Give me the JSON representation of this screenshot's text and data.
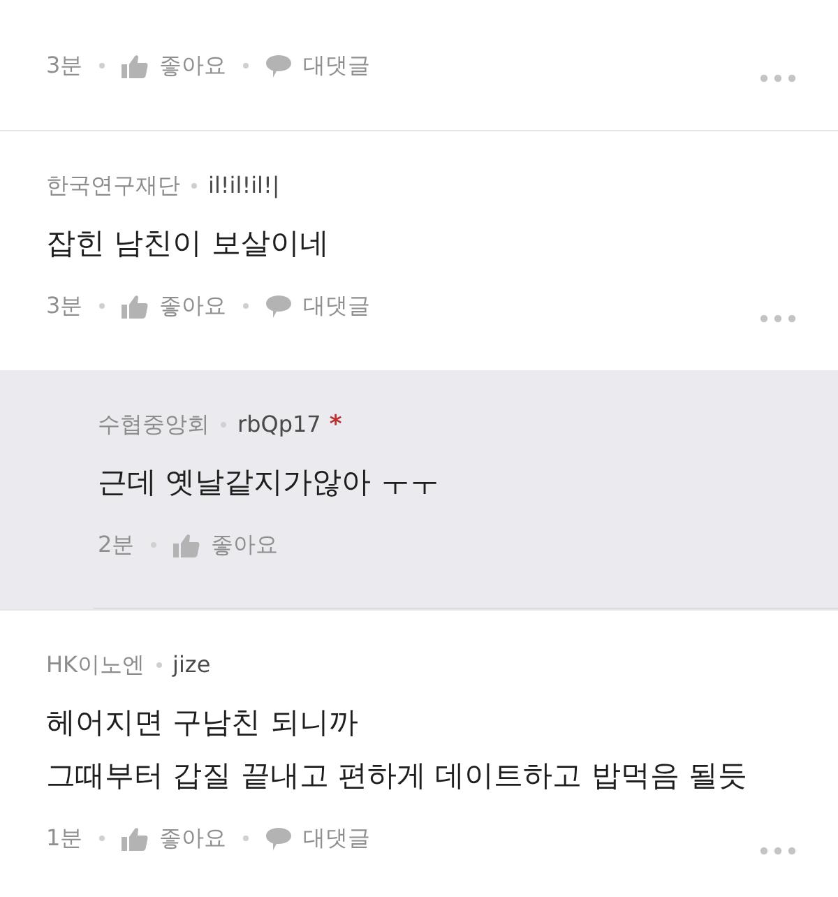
{
  "comments": [
    {
      "kind": "comment",
      "time": "3분",
      "like": "좋아요",
      "reply": "대댓글"
    },
    {
      "kind": "comment",
      "org": "한국연구재단",
      "nickname": "il!il!il!|",
      "body": "잡힌 남친이 보살이네",
      "time": "3분",
      "like": "좋아요",
      "reply": "대댓글"
    },
    {
      "kind": "reply",
      "org": "수협중앙회",
      "nickname": "rbQp17",
      "mark": "*",
      "body": "근데 옛날같지가않아 ㅜㅜ",
      "time": "2분",
      "like": "좋아요"
    },
    {
      "kind": "comment",
      "org": "HK이노엔",
      "nickname": "jize",
      "body": "헤어지면 구남친 되니까\n그때부터 갑질 끝내고 편하게 데이트하고 밥먹음 될듯",
      "time": "1분",
      "like": "좋아요",
      "reply": "대댓글"
    }
  ]
}
